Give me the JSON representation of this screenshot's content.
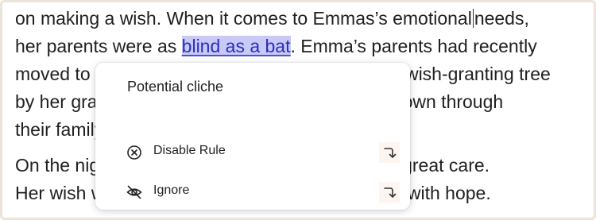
{
  "document": {
    "line1": "on making a wish. When it comes to Emmas’s emotional",
    "line1_after_caret": "needs,",
    "line2_before": "her parents were as ",
    "line2_highlight": "blind as a bat",
    "line2_after": ". Emma’s parents had recently",
    "line3": "moved to the countryside, where they found the wish-granting tree",
    "line4": "by her grandmother’s house, a legend passed down through",
    "line5": "their family for generations, to see if it was true.",
    "line6": "On the night of her birthday the tree was lit with great care.",
    "line7": "Her wish was made, and her parents’ eyes filled with hope."
  },
  "popup": {
    "title": "Potential cliche",
    "actions": [
      {
        "label": "Disable Rule",
        "icon": "circle-x-icon",
        "shortcut_icon": "enter-arrow-icon"
      },
      {
        "label": "Ignore",
        "icon": "eye-off-icon",
        "shortcut_icon": "enter-arrow-icon"
      }
    ]
  },
  "colors": {
    "highlight_bg": "#c8c9f7",
    "highlight_text": "#2a2fbf",
    "frame_border": "#ece4da"
  }
}
